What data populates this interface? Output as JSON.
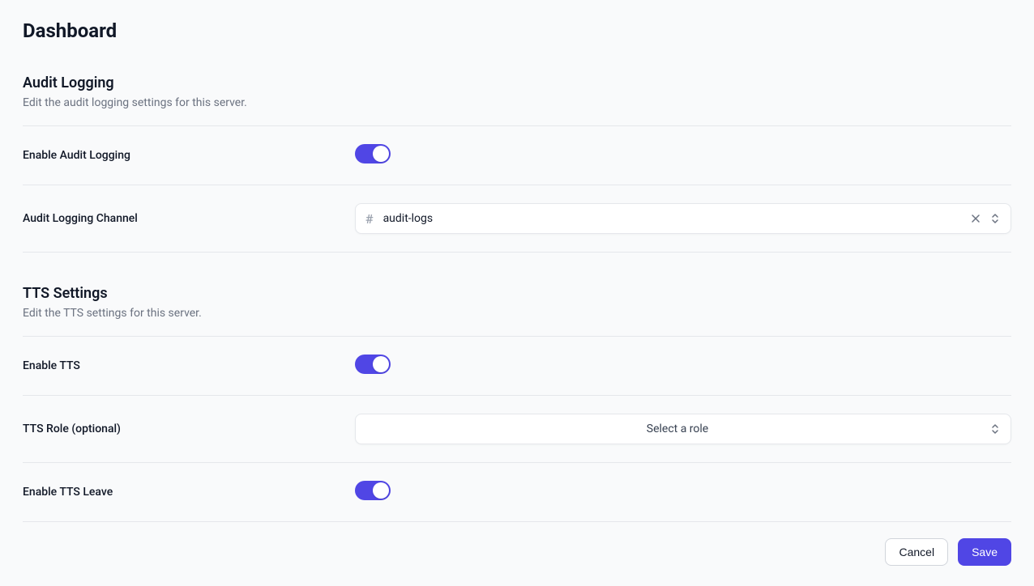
{
  "page": {
    "title": "Dashboard"
  },
  "sections": {
    "auditLogging": {
      "title": "Audit Logging",
      "description": "Edit the audit logging settings for this server.",
      "enableLabel": "Enable Audit Logging",
      "enableValue": true,
      "channelLabel": "Audit Logging Channel",
      "channelValue": "audit-logs"
    },
    "tts": {
      "title": "TTS Settings",
      "description": "Edit the TTS settings for this server.",
      "enableLabel": "Enable TTS",
      "enableValue": true,
      "roleLabel": "TTS Role (optional)",
      "rolePlaceholder": "Select a role",
      "leaveLabel": "Enable TTS Leave",
      "leaveValue": true
    }
  },
  "actions": {
    "cancel": "Cancel",
    "save": "Save"
  },
  "colors": {
    "accent": "#5046e5"
  }
}
